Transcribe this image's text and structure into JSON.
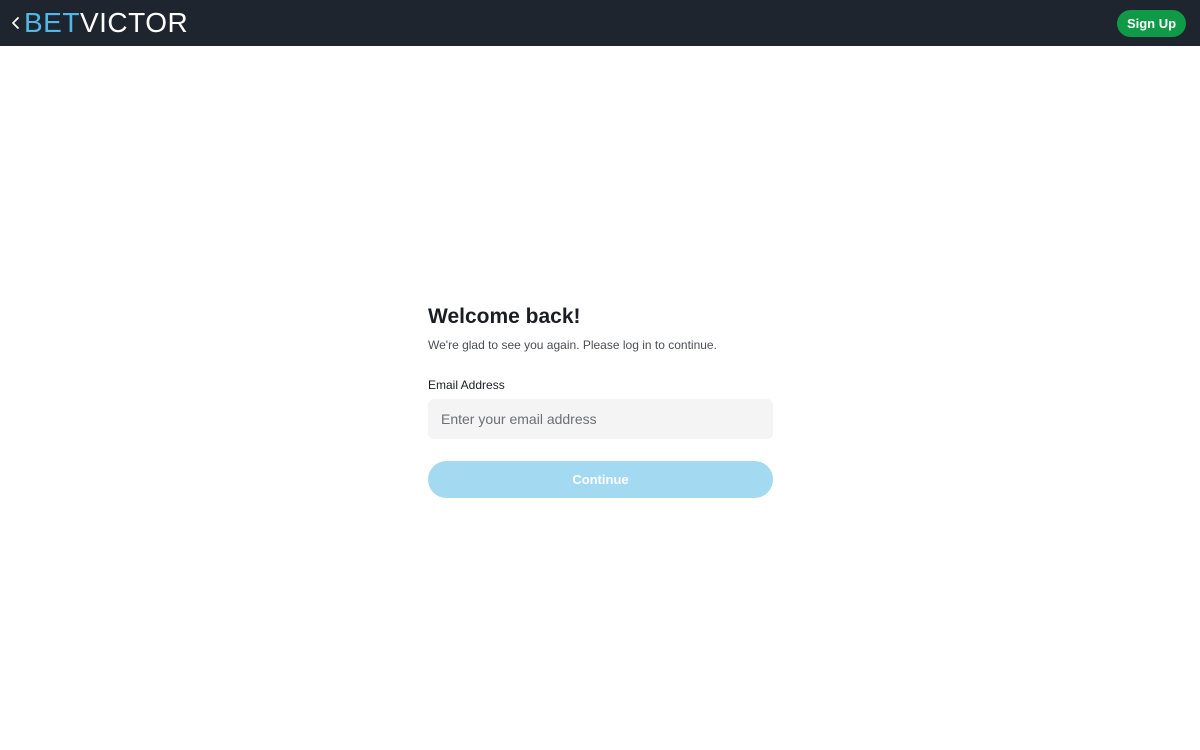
{
  "header": {
    "back_icon": "chevron-left-icon",
    "logo": {
      "part1": "BET",
      "part2": "VICTOR"
    },
    "signup_label": "Sign Up"
  },
  "login": {
    "title": "Welcome back!",
    "subtitle": "We're glad to see you again. Please log in to continue.",
    "email_label": "Email Address",
    "email_placeholder": "Enter your email address",
    "email_value": "",
    "continue_label": "Continue"
  },
  "colors": {
    "header_bg": "#1f252e",
    "logo_bet": "#4fb8e6",
    "logo_victor": "#ffffff",
    "signup_bg": "#0e9a47",
    "continue_bg_disabled": "#a3daf2",
    "input_bg": "#f4f4f4"
  }
}
